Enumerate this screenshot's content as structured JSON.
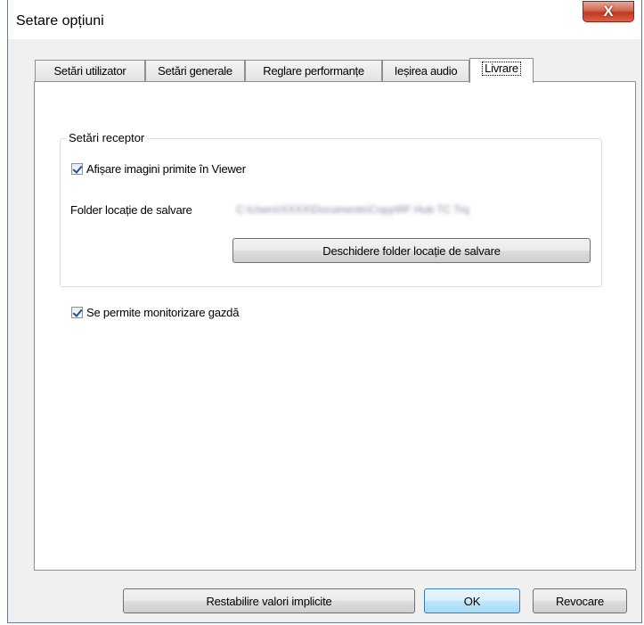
{
  "window": {
    "title": "Setare opțiuni",
    "close_label": "X"
  },
  "tabs": [
    {
      "label": "Setări utilizator",
      "active": false
    },
    {
      "label": "Setări generale",
      "active": false
    },
    {
      "label": "Reglare performanțe",
      "active": false
    },
    {
      "label": "Ieșirea audio",
      "active": false
    },
    {
      "label": "Livrare",
      "active": true
    }
  ],
  "receiver": {
    "group_title": "Setări receptor",
    "show_images_label": "Afișare imagini primite în Viewer",
    "show_images_checked": true,
    "save_folder_label": "Folder locație de salvare",
    "save_folder_value": "C:\\Users\\XXXX\\Documents\\Copy\\RF Hub TC Trq",
    "open_folder_button": "Deschidere folder locație de salvare"
  },
  "host_monitoring": {
    "label": "Se permite monitorizare gazdă",
    "checked": true
  },
  "footer": {
    "restore_button": "Restabilire valori implicite",
    "ok_button": "OK",
    "cancel_button": "Revocare"
  }
}
